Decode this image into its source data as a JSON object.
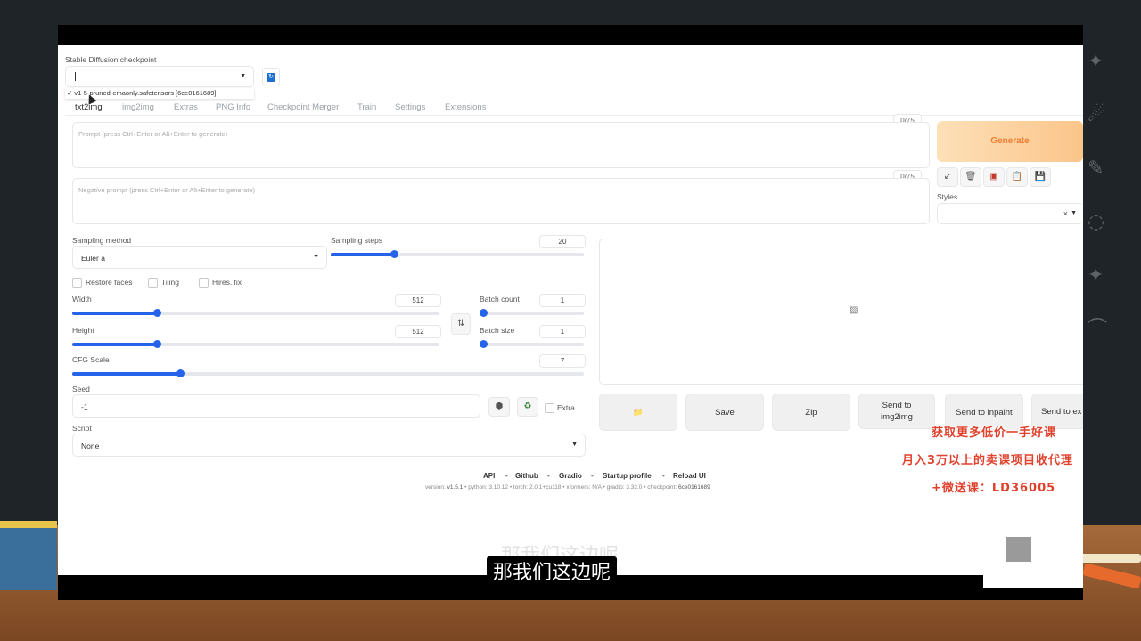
{
  "checkpoint": {
    "label": "Stable Diffusion checkpoint",
    "value": "",
    "option": "v1-5-pruned-emaonly.safetensors [6ce0161689]"
  },
  "tabs": [
    "txt2img",
    "img2img",
    "Extras",
    "PNG Info",
    "Checkpoint Merger",
    "Train",
    "Settings",
    "Extensions"
  ],
  "prompt": {
    "placeholder": "Prompt (press Ctrl+Enter or Alt+Enter to generate)",
    "counter": "0/75"
  },
  "negative": {
    "placeholder": "Negative prompt (press Ctrl+Enter or Alt+Enter to generate)",
    "counter": "0/75"
  },
  "generate": "Generate",
  "styles": {
    "label": "Styles",
    "clear": "×"
  },
  "sampling": {
    "method_label": "Sampling method",
    "method_value": "Euler a",
    "steps_label": "Sampling steps",
    "steps_value": "20",
    "steps_fraction": 0.25
  },
  "checks": {
    "restore_faces": "Restore faces",
    "tiling": "Tiling",
    "hires": "Hires. fix"
  },
  "width": {
    "label": "Width",
    "value": "512",
    "fraction": 0.23
  },
  "height": {
    "label": "Height",
    "value": "512",
    "fraction": 0.23
  },
  "batch_count": {
    "label": "Batch count",
    "value": "1",
    "fraction": 0.0
  },
  "batch_size": {
    "label": "Batch size",
    "value": "1",
    "fraction": 0.0
  },
  "cfg": {
    "label": "CFG Scale",
    "value": "7",
    "fraction": 0.21
  },
  "seed": {
    "label": "Seed",
    "value": "-1",
    "extra": "Extra"
  },
  "script": {
    "label": "Script",
    "value": "None"
  },
  "output_buttons": {
    "folder": "📁",
    "save": "Save",
    "zip": "Zip",
    "img2img": "Send to img2img",
    "inpaint": "Send to inpaint",
    "extras": "Send to ex"
  },
  "footer": {
    "links": [
      "API",
      "Github",
      "Gradio",
      "Startup profile",
      "Reload UI"
    ],
    "version_label": "version:",
    "version": "v1.5.1",
    "python": "python: 3.10.12",
    "torch": "torch: 2.0.1+cu118",
    "xformers": "xformers: N/A",
    "gradio": "gradio: 3.32.0",
    "checkpoint_label": "checkpoint:",
    "checkpoint": "6ce0161689"
  },
  "promo": [
    "获取更多低价一手好课",
    "月入3万以上的卖课项目收代理",
    "+微送课：LD36005"
  ],
  "subtitle": "那我们这边呢",
  "colors": {
    "accent": "#2563eb",
    "generate": "#ee7c2f",
    "promo": "#e0412d"
  }
}
